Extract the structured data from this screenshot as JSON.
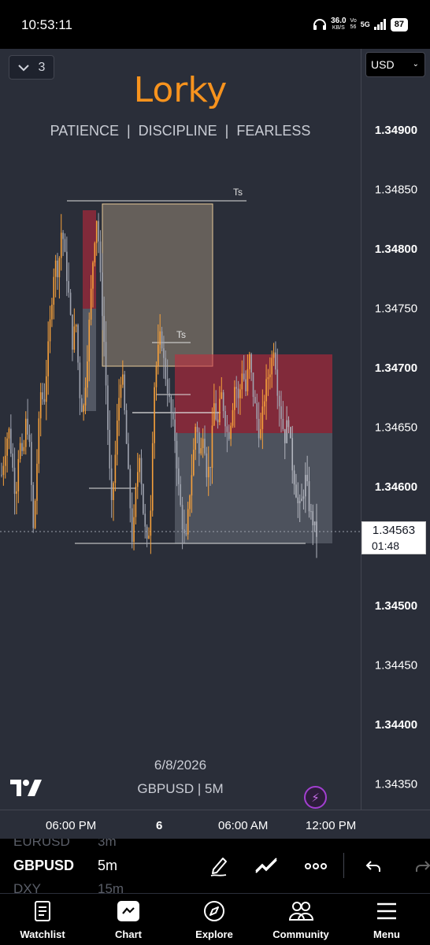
{
  "status_bar": {
    "time": "10:53:11",
    "net_speed": "36.0",
    "net_unit": "KB/S",
    "volte_top": "Vo",
    "volte_bottom": "56",
    "network": "5G",
    "battery": "87"
  },
  "chart": {
    "layers_count": "3",
    "watermark_title": "Lorky",
    "watermark_subtitle": "PATIENCE  |  DISCIPLINE  |  FEARLESS",
    "currency": "USD",
    "date_label": "6/8/2026",
    "symbol_label": "GBPUSD | 5M",
    "annotations": [
      "Ts",
      "Ts"
    ],
    "current_price": "1.34563",
    "countdown": "01:48"
  },
  "chart_data": {
    "type": "candlestick",
    "symbol": "GBPUSD",
    "timeframe": "5M",
    "price_ticks": [
      "1.34900",
      "1.34850",
      "1.34800",
      "1.34750",
      "1.34700",
      "1.34650",
      "1.34600",
      "1.34500",
      "1.34450",
      "1.34400",
      "1.34350"
    ],
    "bold_ticks": [
      "1.34900",
      "1.34800",
      "1.34700",
      "1.34600",
      "1.34500",
      "1.34400"
    ],
    "ylim": [
      1.3432,
      1.3494
    ],
    "time_ticks": [
      "06:00 PM",
      "6",
      "06:00 AM",
      "12:00 PM"
    ],
    "last_price": 1.34563,
    "close_path": [
      1.3461,
      1.3463,
      1.3465,
      1.3462,
      1.3459,
      1.3464,
      1.3462,
      1.3466,
      1.3463,
      1.3456,
      1.3462,
      1.3468,
      1.3467,
      1.3471,
      1.3475,
      1.3479,
      1.3478,
      1.3482,
      1.3479,
      1.3476,
      1.3472,
      1.3474,
      1.3468,
      1.3466,
      1.347,
      1.3475,
      1.348,
      1.3483,
      1.3477,
      1.3472,
      1.3465,
      1.3458,
      1.3462,
      1.3467,
      1.347,
      1.3465,
      1.346,
      1.3455,
      1.346,
      1.3463,
      1.3458,
      1.3455,
      1.3457,
      1.3468,
      1.3471,
      1.3473,
      1.347,
      1.3468,
      1.3466,
      1.3464,
      1.346,
      1.3457,
      1.3455,
      1.3459,
      1.3462,
      1.3466,
      1.3462,
      1.3465,
      1.3461,
      1.3462,
      1.3467,
      1.3465,
      1.3468,
      1.3466,
      1.3464,
      1.3466,
      1.3469,
      1.3467,
      1.347,
      1.3468,
      1.3471,
      1.3468,
      1.3466,
      1.3464,
      1.3467,
      1.3469,
      1.347,
      1.3472,
      1.3468,
      1.3466,
      1.3464,
      1.3466,
      1.3462,
      1.346,
      1.3458,
      1.3459,
      1.3461,
      1.3458,
      1.3457,
      1.3456
    ]
  },
  "toolbar": {
    "watchlist_prev": "EURUSD",
    "watchlist_prev_tf": "3m",
    "symbol": "GBPUSD",
    "timeframe": "5m",
    "watchlist_next": "DXY",
    "watchlist_next_tf": "15m"
  },
  "nav": {
    "items": [
      "Watchlist",
      "Chart",
      "Explore",
      "Community",
      "Menu"
    ]
  }
}
